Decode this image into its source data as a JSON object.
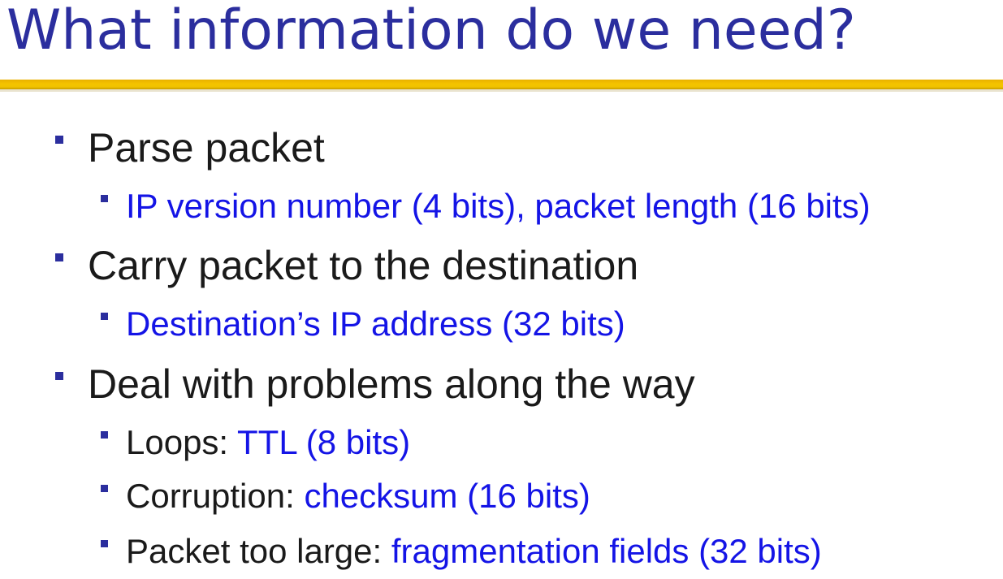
{
  "slide": {
    "title": "What information do we need?",
    "colors": {
      "title": "#2b2e9e",
      "bullet_marker": "#2b2e9e",
      "body_text": "#1a1a1a",
      "highlight_text": "#1414e6",
      "rule": "#f0c000"
    }
  },
  "bullets": [
    {
      "label": "Parse packet",
      "sub": [
        {
          "prefix": "",
          "detail": "IP version number (4 bits), packet length (16 bits)"
        }
      ]
    },
    {
      "label": "Carry packet to the destination",
      "sub": [
        {
          "prefix": "",
          "detail": "Destination’s IP address (32 bits)"
        }
      ]
    },
    {
      "label": "Deal with problems along the way",
      "sub": [
        {
          "prefix": "Loops: ",
          "detail": "TTL (8 bits)"
        },
        {
          "prefix": "Corruption: ",
          "detail": "checksum (16 bits)"
        },
        {
          "prefix": "Packet too large: ",
          "detail": "fragmentation fields (32 bits)"
        }
      ]
    }
  ]
}
